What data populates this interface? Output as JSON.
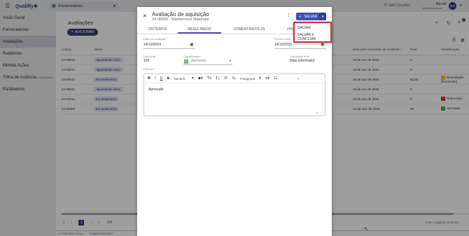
{
  "topbar": {
    "logo": "Qualifty✚",
    "module": "Fornecedores",
    "context": "YL EAD (Qualify)",
    "user_name": "Nicole",
    "user_role": "Administradora",
    "avatar": "NG"
  },
  "sidebar": {
    "items": [
      {
        "label": "Visão Geral"
      },
      {
        "label": "Fornecedores"
      },
      {
        "label": "Avaliações"
      },
      {
        "label": "Relatórios"
      },
      {
        "label": "Minhas Ações"
      },
      {
        "label": "Trilha de Auditoria",
        "sub": "(Simplificada)"
      },
      {
        "label": "Parâmetros"
      }
    ]
  },
  "page": {
    "title": "Avaliações",
    "add_label": "ADICIONAR",
    "notif_count": "1"
  },
  "table": {
    "headers": [
      "Código",
      "Status",
      "Data para conclusão da avaliação",
      "Nota",
      "Classificação"
    ],
    "rows": [
      {
        "code": "24-00015",
        "status": "Aguardando início",
        "date": "19 de out. de 2024",
        "note": "0",
        "class": "",
        "class_color": "",
        "late": false
      },
      {
        "code": "24-00014",
        "status": "Aguardando início",
        "date": "19 de out. de 2024",
        "note": "0",
        "class": "",
        "class_color": "",
        "late": false
      },
      {
        "code": "24-00013",
        "status": "Em andamento",
        "date": "19 de out. de 2024",
        "note": "62,50",
        "class": "Reavaliação [Removido]",
        "class_color": "#e7d21f",
        "late": false
      },
      {
        "code": "24-00012",
        "status": "Aguardando início",
        "date": "19 de out. de 2024",
        "note": "0",
        "class": "",
        "class_color": "",
        "late": false
      },
      {
        "code": "24-00011",
        "status": "Em andamento",
        "date": "19 de out. de 2024",
        "note": "0",
        "class": "Reprovado",
        "class_color": "#c0392b",
        "late": false
      },
      {
        "code": "24-00005",
        "status": "Em andamento",
        "date": "14 de mai. de 2024",
        "note": "85",
        "class": "Aprovado",
        "class_color": "#4caf50",
        "late": true
      }
    ]
  },
  "pager": {
    "first": "«",
    "prev": "‹",
    "page": "1",
    "next": "›",
    "last": "»",
    "size": "100",
    "info": "1 de 1 páginas (6 itens)"
  },
  "footer": {
    "copyright": "© FORLOGIC 2024",
    "module": "FORNECEDORES"
  },
  "dialog": {
    "title": "Avaliação de aquisição",
    "subtitle": "24-00005 - Maxforrrece Materials",
    "save_label": "SALVAR",
    "tabs": [
      "CRITÉRIOS",
      "RESULTADOS",
      "COMENTÁRIOS (0)",
      "HIST"
    ],
    "date_label": "Data da avaliação *",
    "date_value": "14/10/2024",
    "next_label": "Próxima aval...",
    "next_value": "14/10/2025",
    "note_label": "Nota final",
    "note_value": "100",
    "class_label": "Classificação *",
    "class_value": "Aprovado",
    "approval_label": "Aprovação final",
    "approval_value": "[Não informado]",
    "opinion_label": "Parecer *",
    "toolbar": {
      "size": "Tamanh...",
      "format": "Paragraph"
    },
    "opinion_text": "Aprovado",
    "char_count": "0"
  },
  "save_menu": {
    "options": [
      "SALVAR",
      "SALVAR E CONCLUIR"
    ]
  }
}
